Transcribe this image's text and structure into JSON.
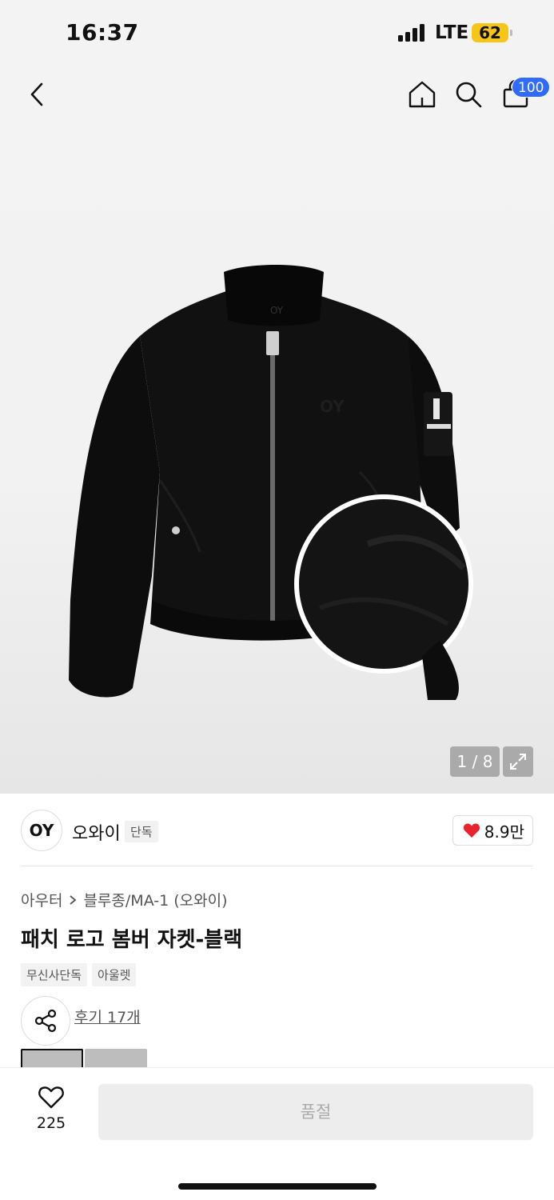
{
  "status": {
    "time": "16:37",
    "network": "LTE",
    "battery": "62"
  },
  "nav": {
    "cart_count": "100",
    "icons": [
      "back-icon",
      "home-icon",
      "search-icon",
      "cart-icon"
    ]
  },
  "gallery": {
    "page_indicator": "1 / 8",
    "logo_on_jacket": "OY"
  },
  "brand": {
    "logo": "OY",
    "name": "오와이",
    "tag": "단독",
    "likes": "8.9만"
  },
  "product": {
    "breadcrumb": [
      "아우터",
      "블루종/MA-1 (오와이)"
    ],
    "title": "패치 로고 봄버 자켓-블랙",
    "tags": [
      "무신사단독",
      "아울렛"
    ],
    "review_link": "후기 17개"
  },
  "bottom": {
    "wish_count": "225",
    "action_label": "품절"
  },
  "colors": {
    "accent_blue": "#2f6bff",
    "heart_red": "#e8222e",
    "battery_yellow": "#f5c518"
  }
}
